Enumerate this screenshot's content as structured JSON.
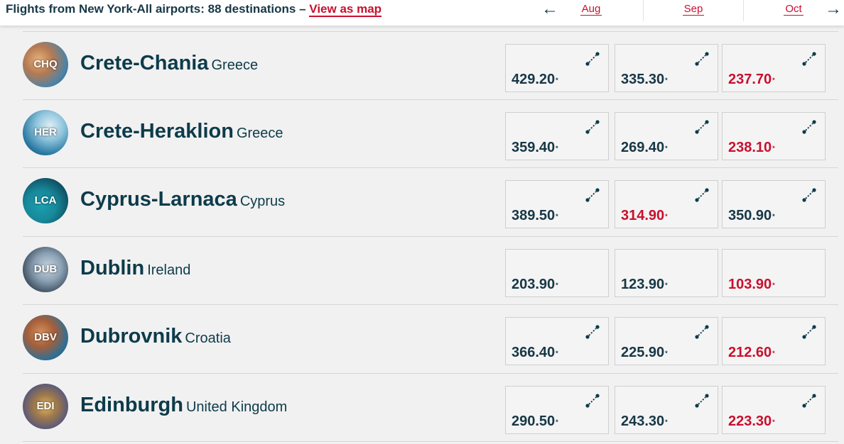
{
  "header": {
    "title": "Flights from New York-All airports: 88 destinations –",
    "map_link": "View as map",
    "months": [
      "Aug",
      "Sep",
      "Oct"
    ],
    "prev_icon": "arrow-left-icon",
    "next_icon": "arrow-right-icon"
  },
  "colors": {
    "brand_red": "#c8102e",
    "text_dark": "#0d3b4a"
  },
  "destinations": [
    {
      "code": "CHQ",
      "city": "Crete-Chania",
      "country": "Greece",
      "prices": [
        {
          "value": "429.20",
          "low": false,
          "icon": true
        },
        {
          "value": "335.30",
          "low": false,
          "icon": true
        },
        {
          "value": "237.70",
          "low": true,
          "icon": true
        }
      ]
    },
    {
      "code": "HER",
      "city": "Crete-Heraklion",
      "country": "Greece",
      "prices": [
        {
          "value": "359.40",
          "low": false,
          "icon": true
        },
        {
          "value": "269.40",
          "low": false,
          "icon": true
        },
        {
          "value": "238.10",
          "low": true,
          "icon": true
        }
      ]
    },
    {
      "code": "LCA",
      "city": "Cyprus-Larnaca",
      "country": "Cyprus",
      "prices": [
        {
          "value": "389.50",
          "low": false,
          "icon": true
        },
        {
          "value": "314.90",
          "low": true,
          "icon": true
        },
        {
          "value": "350.90",
          "low": false,
          "icon": true
        }
      ]
    },
    {
      "code": "DUB",
      "city": "Dublin",
      "country": "Ireland",
      "prices": [
        {
          "value": "203.90",
          "low": false,
          "icon": false
        },
        {
          "value": "123.90",
          "low": false,
          "icon": false
        },
        {
          "value": "103.90",
          "low": true,
          "icon": false
        }
      ]
    },
    {
      "code": "DBV",
      "city": "Dubrovnik",
      "country": "Croatia",
      "prices": [
        {
          "value": "366.40",
          "low": false,
          "icon": true
        },
        {
          "value": "225.90",
          "low": false,
          "icon": true
        },
        {
          "value": "212.60",
          "low": true,
          "icon": true
        }
      ]
    },
    {
      "code": "EDI",
      "city": "Edinburgh",
      "country": "United Kingdom",
      "prices": [
        {
          "value": "290.50",
          "low": false,
          "icon": true
        },
        {
          "value": "243.30",
          "low": false,
          "icon": true
        },
        {
          "value": "223.30",
          "low": true,
          "icon": true
        }
      ]
    }
  ],
  "price_marker": "*"
}
